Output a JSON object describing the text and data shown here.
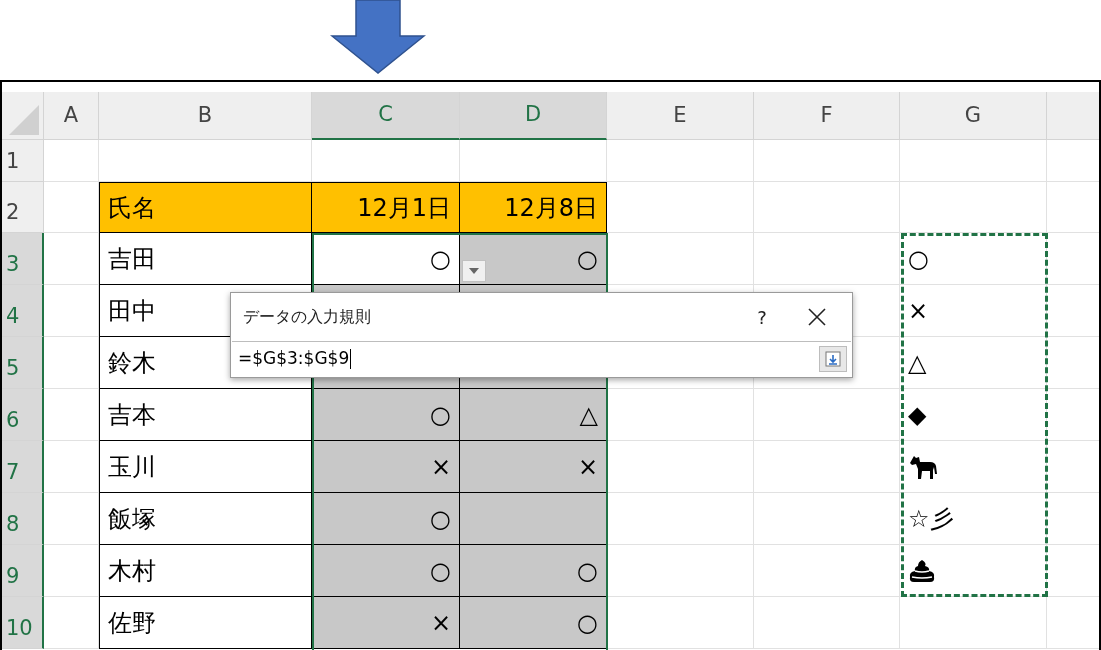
{
  "columns": [
    {
      "label": "A",
      "selected": false
    },
    {
      "label": "B",
      "selected": false
    },
    {
      "label": "C",
      "selected": true
    },
    {
      "label": "D",
      "selected": true
    },
    {
      "label": "E",
      "selected": false
    },
    {
      "label": "F",
      "selected": false
    },
    {
      "label": "G",
      "selected": false
    }
  ],
  "rows": [
    {
      "number": "1",
      "selected": false,
      "kind": "blank"
    },
    {
      "number": "2",
      "selected": false,
      "kind": "header",
      "b": "氏名",
      "c": "12月1日",
      "d": "12月8日"
    },
    {
      "number": "3",
      "selected": true,
      "kind": "data",
      "b": "吉田",
      "c": "○",
      "d": "○",
      "active": true,
      "dropdown": true,
      "g": {
        "kind": "text",
        "text": "○"
      }
    },
    {
      "number": "4",
      "selected": true,
      "kind": "data",
      "b": "田中",
      "active": false,
      "g": {
        "kind": "text",
        "text": "×"
      }
    },
    {
      "number": "5",
      "selected": true,
      "kind": "data",
      "b": "鈴木",
      "active": false,
      "g": {
        "kind": "text",
        "text": "△"
      }
    },
    {
      "number": "6",
      "selected": true,
      "kind": "data",
      "b": "吉本",
      "c": "○",
      "d": "△",
      "active": false,
      "g": {
        "kind": "text",
        "text": "◆"
      }
    },
    {
      "number": "7",
      "selected": true,
      "kind": "data",
      "b": "玉川",
      "c": "×",
      "d": "×",
      "active": false,
      "g": {
        "kind": "horse"
      }
    },
    {
      "number": "8",
      "selected": true,
      "kind": "data",
      "b": "飯塚",
      "c": "○",
      "active": false,
      "g": {
        "kind": "text",
        "text": "☆彡"
      }
    },
    {
      "number": "9",
      "selected": true,
      "kind": "data",
      "b": "木村",
      "c": "○",
      "d": "○",
      "active": false,
      "g": {
        "kind": "poop"
      }
    },
    {
      "number": "10",
      "selected": true,
      "kind": "data",
      "b": "佐野",
      "c": "×",
      "d": "○",
      "active": false
    }
  ],
  "dialog": {
    "title": "データの入力規則",
    "help": "?",
    "value": "=$G$3:$G$9"
  }
}
